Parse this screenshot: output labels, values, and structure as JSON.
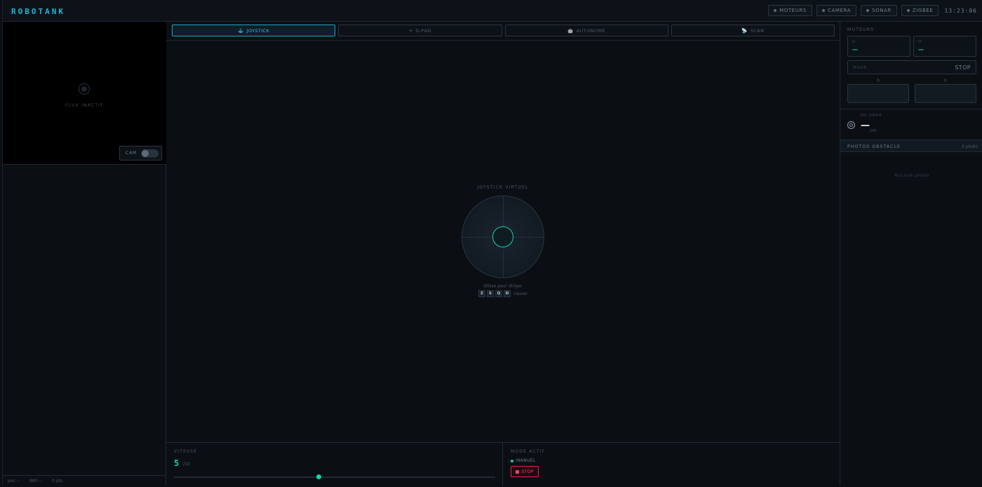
{
  "header": {
    "brand": "ROBOTANK",
    "statuses": [
      {
        "label": "MOTEURS"
      },
      {
        "label": "CAMÉRA"
      },
      {
        "label": "SONAR"
      },
      {
        "label": "ZIGBEE"
      }
    ],
    "clock": "13:23:06"
  },
  "camera": {
    "status_label": "FLUX INACTIF",
    "toggle_label": "CAM",
    "toggle_on": false
  },
  "left_footer": {
    "pos": "pos --",
    "wifi": "WiFi --",
    "points": "0 pts"
  },
  "tabs": [
    {
      "icon": "🕹",
      "label": "JOYSTICK",
      "active": true
    },
    {
      "icon": "✛",
      "label": "D-PAD",
      "active": false
    },
    {
      "icon": "🤖",
      "label": "AUTONOME",
      "active": false
    },
    {
      "icon": "📡",
      "label": "SCAN",
      "active": false
    }
  ],
  "joystick": {
    "title": "JOYSTICK VIRTUEL",
    "hint": "Glisse pour diriger",
    "keys": [
      "Z",
      "S",
      "Q",
      "D"
    ],
    "keys_suffix": "clavier"
  },
  "speed": {
    "label": "VITESSE",
    "value": "5",
    "unit": "/10",
    "slider_fraction": 0.45
  },
  "mode": {
    "label": "MODE ACTIF",
    "state": "MANUEL",
    "stop_label": "STOP"
  },
  "motors": {
    "label": "MOTEURS",
    "left": {
      "key": "G",
      "value": "—"
    },
    "right": {
      "key": "D",
      "value": "—"
    },
    "mode_key": "MODE",
    "mode_value": "STOP",
    "bars": [
      {
        "value": "0"
      },
      {
        "value": "0"
      }
    ]
  },
  "sonar": {
    "sensor": "HC-SR04",
    "value": "—",
    "unit": "cm"
  },
  "photos": {
    "title": "PHOTOS OBSTACLE",
    "count": "0 photo",
    "empty": "Aucune photo"
  }
}
